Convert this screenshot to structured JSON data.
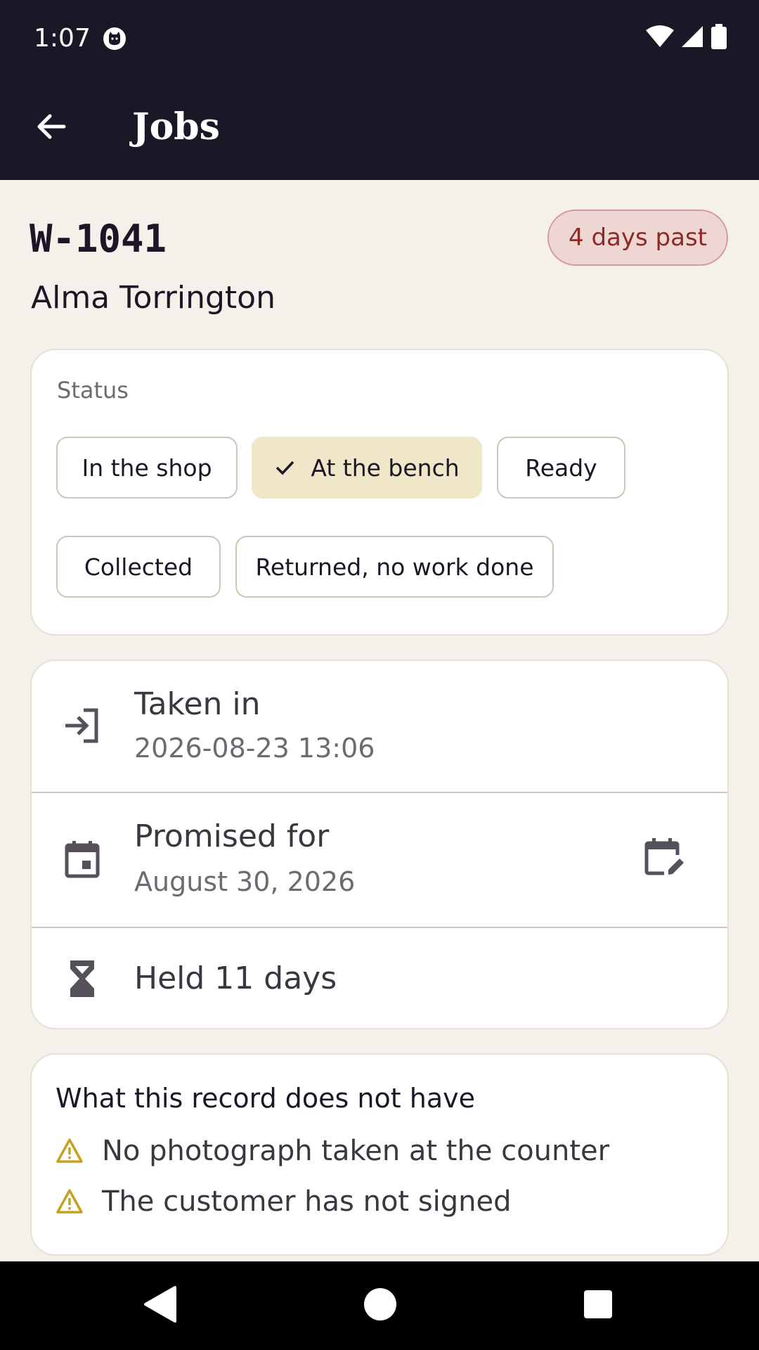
{
  "status_bar": {
    "time": "1:07",
    "icons": [
      "cat-notification-icon",
      "wifi-icon",
      "signal-icon",
      "battery-icon"
    ]
  },
  "app_bar": {
    "title": "Jobs",
    "back_icon": "arrow-left-icon"
  },
  "job": {
    "id": "W-1041",
    "overdue_badge": "4 days past",
    "customer": "Alma Torrington"
  },
  "status": {
    "label": "Status",
    "options": [
      {
        "label": "In the shop",
        "selected": false
      },
      {
        "label": "At the bench",
        "selected": true
      },
      {
        "label": "Ready",
        "selected": false
      },
      {
        "label": "Collected",
        "selected": false
      },
      {
        "label": "Returned, no work done",
        "selected": false
      }
    ]
  },
  "dates": {
    "taken_in": {
      "title": "Taken in",
      "value": "2026-08-23 13:06",
      "icon": "login-arrow-icon"
    },
    "promised": {
      "title": "Promised for",
      "value": "August 30, 2026",
      "icon": "calendar-icon",
      "action_icon": "edit-calendar-icon"
    },
    "held": {
      "title": "Held 11 days",
      "icon": "hourglass-icon"
    }
  },
  "missing": {
    "title": "What this record does not have",
    "items": [
      "No photograph taken at the counter",
      "The customer has not signed"
    ],
    "icon": "warning-icon"
  },
  "colors": {
    "dark": "#1c1727",
    "background": "#f4f1eb",
    "selected_chip": "#f0e6c8",
    "badge_bg": "#eed6d2",
    "badge_text": "#8c2a2a",
    "warning": "#c8a020"
  },
  "nav": {
    "icons": [
      "back-triangle-icon",
      "home-circle-icon",
      "recents-square-icon"
    ]
  }
}
